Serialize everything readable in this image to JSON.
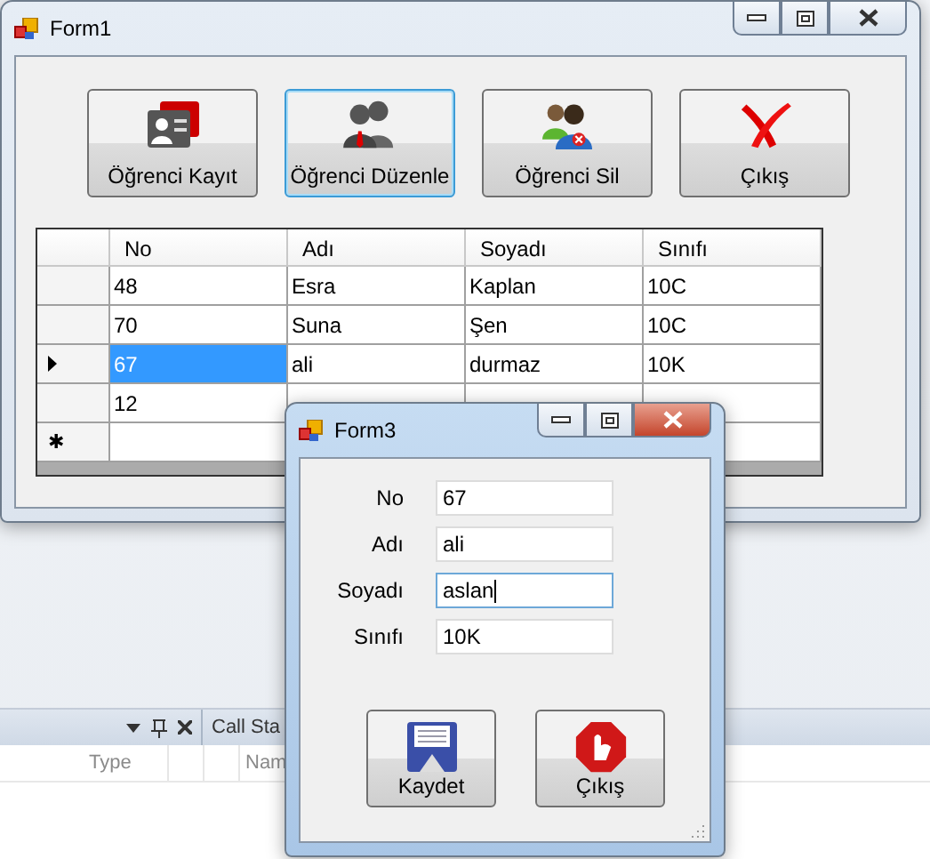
{
  "form1": {
    "title": "Form1",
    "buttons": [
      {
        "label": "Öğrenci Kayıt",
        "focused": false
      },
      {
        "label": "Öğrenci Düzenle",
        "focused": true
      },
      {
        "label": "Öğrenci Sil",
        "focused": false
      },
      {
        "label": "Çıkış",
        "focused": false
      }
    ],
    "grid": {
      "columns": [
        "No",
        "Adı",
        "Soyadı",
        "Sınıfı"
      ],
      "rows": [
        {
          "current": false,
          "cells": [
            {
              "text": "48",
              "selected": false
            },
            {
              "text": "Esra",
              "selected": false
            },
            {
              "text": "Kaplan",
              "selected": false
            },
            {
              "text": "10C",
              "selected": false
            }
          ]
        },
        {
          "current": false,
          "cells": [
            {
              "text": "70",
              "selected": false
            },
            {
              "text": "Suna",
              "selected": false
            },
            {
              "text": "Şen",
              "selected": false
            },
            {
              "text": "10C",
              "selected": false
            }
          ]
        },
        {
          "current": true,
          "cells": [
            {
              "text": "67",
              "selected": true
            },
            {
              "text": "ali",
              "selected": false
            },
            {
              "text": "durmaz",
              "selected": false
            },
            {
              "text": "10K",
              "selected": false
            }
          ]
        },
        {
          "current": false,
          "cells": [
            {
              "text": "12",
              "selected": false
            }
          ]
        }
      ],
      "new_row_marker": "✱"
    }
  },
  "ide_panel": {
    "column_1": "Type",
    "tab": "Call Sta",
    "column_2": "Nam"
  },
  "form3": {
    "title": "Form3",
    "fields": [
      {
        "label": "No",
        "value": "67",
        "focused": false
      },
      {
        "label": "Adı",
        "value": "ali",
        "focused": false
      },
      {
        "label": "Soyadı",
        "value": "aslan",
        "focused": true
      },
      {
        "label": "Sınıfı",
        "value": "10K",
        "focused": false
      }
    ],
    "buttons": [
      {
        "label": "Kaydet"
      },
      {
        "label": "Çıkış"
      }
    ]
  }
}
